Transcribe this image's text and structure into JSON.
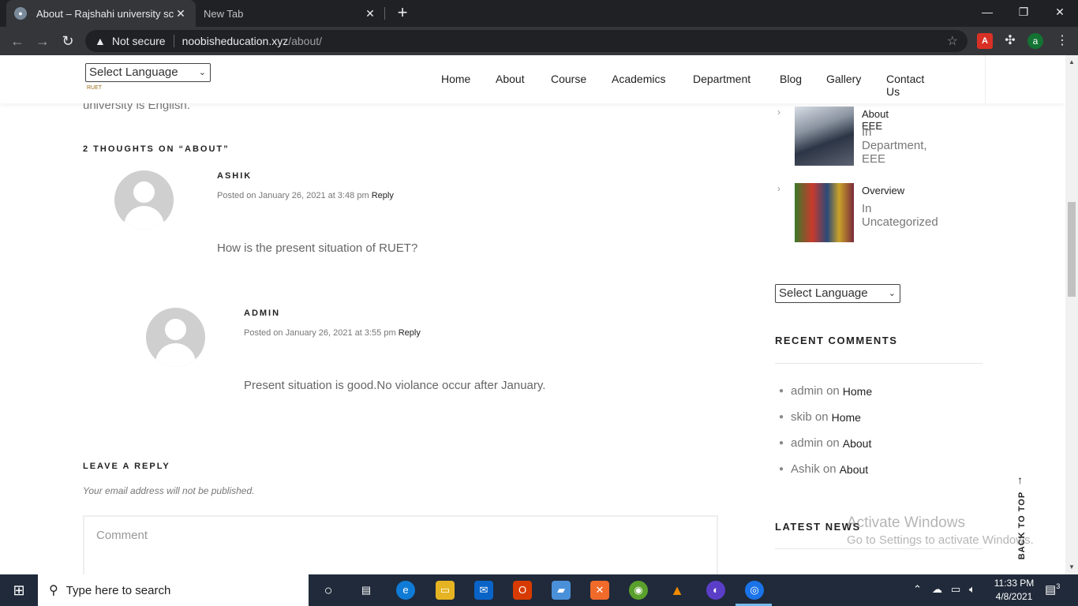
{
  "browser": {
    "tabs": [
      {
        "title": "About – Rajshahi university scien"
      },
      {
        "title": "New Tab"
      }
    ],
    "security_label": "Not secure",
    "url_domain": "noobisheducation.xyz",
    "url_path": "/about/",
    "profile_initial": "a",
    "pdf_ext_label": "A"
  },
  "header": {
    "lang_select": "Select Language",
    "logo_text": "RUET",
    "nav": [
      "Home",
      "About",
      "Course",
      "Academics",
      "Department",
      "Blog",
      "Gallery",
      "Contact Us"
    ]
  },
  "article": {
    "trailing_text": "university is English.",
    "thoughts_title": "2 THOUGHTS ON “ABOUT”"
  },
  "comments": [
    {
      "author": "ASHIK",
      "posted": "Posted on January 26, 2021 at 3:48 pm",
      "reply": "Reply",
      "body": "How is the present situation of RUET?"
    },
    {
      "author": "ADMIN",
      "posted": "Posted on January 26, 2021 at 3:55 pm",
      "reply": "Reply",
      "body": "Present situation is good.No violance occur after January."
    }
  ],
  "reply_form": {
    "title": "LEAVE A REPLY",
    "note": "Your email address will not be published.",
    "comment_placeholder": "Comment"
  },
  "sidebar": {
    "posts": [
      {
        "title": "About EEE",
        "category": "In Department, EEE"
      },
      {
        "title": "Overview",
        "category": "In Uncategorized"
      }
    ],
    "lang_select": "Select Language",
    "recent_comments_title": "RECENT COMMENTS",
    "recent_comments": [
      {
        "author": "admin",
        "on": "on",
        "link": "Home"
      },
      {
        "author": "skib",
        "on": "on",
        "link": "Home"
      },
      {
        "author": "admin",
        "on": "on",
        "link": "About"
      },
      {
        "author": "Ashik",
        "on": "on",
        "link": "About"
      }
    ],
    "latest_news_title": "LATEST NEWS"
  },
  "overlay": {
    "activate_title": "Activate Windows",
    "activate_sub": "Go to Settings to activate Windows.",
    "back_to_top": "BACK TO TOP"
  },
  "taskbar": {
    "search_placeholder": "Type here to search",
    "time": "11:33 PM",
    "date": "4/8/2021",
    "notification_count": "3"
  }
}
